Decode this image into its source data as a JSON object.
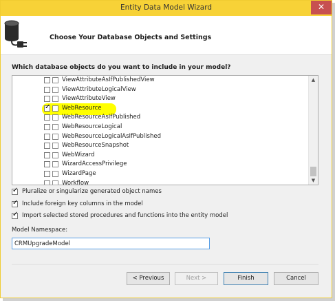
{
  "window": {
    "title": "Entity Data Model Wizard",
    "close_glyph": "✕"
  },
  "header": {
    "title": "Choose Your Database Objects and Settings",
    "icon": "database-plug-icon"
  },
  "question": "Which database objects do you want to include in your model?",
  "objects": [
    {
      "label": "ViewAttributeAsIfPublishedView",
      "checked": false,
      "highlighted": false
    },
    {
      "label": "ViewAttributeLogicalView",
      "checked": false,
      "highlighted": false
    },
    {
      "label": "ViewAttributeView",
      "checked": false,
      "highlighted": false
    },
    {
      "label": "WebResource",
      "checked": true,
      "highlighted": true
    },
    {
      "label": "WebResourceAsIfPublished",
      "checked": false,
      "highlighted": false
    },
    {
      "label": "WebResourceLogical",
      "checked": false,
      "highlighted": false
    },
    {
      "label": "WebResourceLogicalAsIfPublished",
      "checked": false,
      "highlighted": false
    },
    {
      "label": "WebResourceSnapshot",
      "checked": false,
      "highlighted": false
    },
    {
      "label": "WebWizard",
      "checked": false,
      "highlighted": false
    },
    {
      "label": "WizardAccessPrivilege",
      "checked": false,
      "highlighted": false
    },
    {
      "label": "WizardPage",
      "checked": false,
      "highlighted": false
    },
    {
      "label": "Workflow",
      "checked": false,
      "highlighted": false
    }
  ],
  "options": {
    "pluralize": {
      "label": "Pluralize or singularize generated object names",
      "checked": true
    },
    "foreign_keys": {
      "label": "Include foreign key columns in the model",
      "checked": true
    },
    "stored_procs": {
      "label": "Import selected stored procedures and functions into the entity model",
      "checked": true
    }
  },
  "namespace": {
    "label": "Model Namespace:",
    "value": "CRMUpgradeModel"
  },
  "buttons": {
    "previous": "< Previous",
    "next": "Next >",
    "finish": "Finish",
    "cancel": "Cancel"
  },
  "colors": {
    "titlebar": "#f7d237",
    "highlight": "#ffff00",
    "close": "#c75050"
  }
}
